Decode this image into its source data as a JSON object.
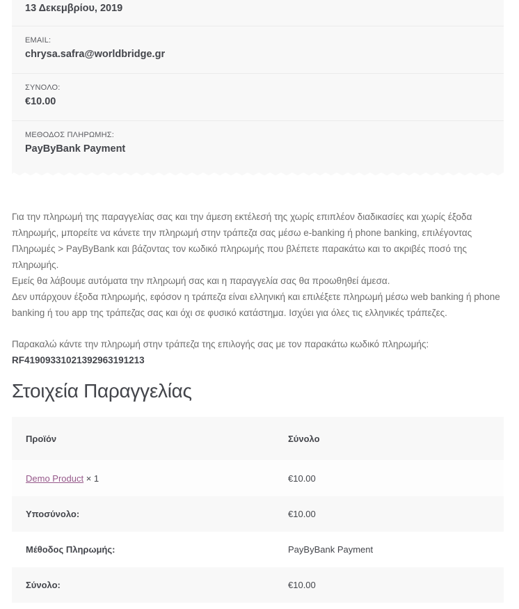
{
  "overview": {
    "date_value": "13 Δεκεμβρίου, 2019",
    "email_label": "EMAIL:",
    "email_value": "chrysa.safra@worldbridge.gr",
    "total_label": "ΣΥΝΟΛΟ:",
    "total_value": "€10.00",
    "method_label": "ΜΕΘΟΔΟΣ ΠΛΗΡΩΜΗΣ:",
    "method_value": "PayByBank Payment"
  },
  "instructions": {
    "line1": "Για την πληρωμή της παραγγελίας σας και την άμεση εκτέλεσή της χωρίς επιπλέον διαδικασίες και χωρίς έξοδα πληρωμής, μπορείτε να κάνετε την πληρωμή στην τράπεζα σας μέσω e-banking ή phone banking, επιλέγοντας Πληρωμές > PayByBank και βάζοντας τον κωδικό πληρωμής που βλέπετε παρακάτω και το ακριβές ποσό της πληρωμής.",
    "line2": "Εμείς θα λάβουμε αυτόματα την πληρωμή σας και η παραγγελία σας θα προωθηθεί άμεσα.",
    "line3": "Δεν υπάρχουν έξοδα πληρωμής, εφόσον η τράπεζα είναι ελληνική και επιλέξετε πληρωμή μέσω web banking ή phone banking ή του app της τράπεζας σας και όχι σε φυσικό κατάστημα. Ισχύει για όλες τις ελληνικές τράπεζες.",
    "pay_prompt": "Παρακαλώ κάντε την πληρωμή στην τράπεζα της επιλογής σας με τον παρακάτω κωδικό πληρωμής:",
    "pay_code": "RF41909331021392963191213"
  },
  "order_details": {
    "title": "Στοιχεία Παραγγελίας",
    "col_product": "Προϊόν",
    "col_total": "Σύνολο",
    "item": {
      "name": "Demo Product",
      "qty": "× 1",
      "total": "€10.00"
    },
    "subtotal_label": "Υποσύνολο:",
    "subtotal_value": "€10.00",
    "payment_label": "Μέθοδος Πληρωμής:",
    "payment_value": "PayByBank Payment",
    "grand_label": "Σύνολο:",
    "grand_value": "€10.00"
  },
  "colors": {
    "link": "#96588a",
    "panel": "#f8f8f8",
    "text": "#43454b"
  }
}
